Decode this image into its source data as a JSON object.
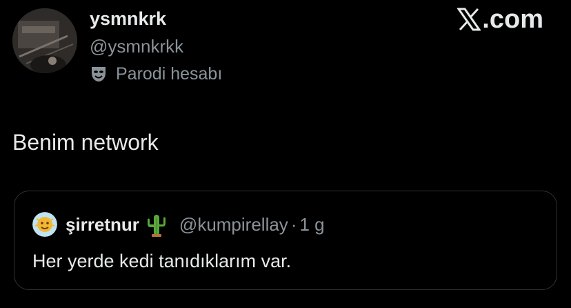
{
  "author": {
    "display_name": "ysmnkrk",
    "handle": "@ysmnkrkk",
    "badge_label": "Parodi hesabı",
    "badge_icon": "theater-mask-icon"
  },
  "watermark": {
    "text": ".com",
    "icon": "x-logo-icon"
  },
  "tweet": {
    "text": "Benim network"
  },
  "quoted_tweet": {
    "display_name": "şirretnur",
    "name_emoji": "cactus-icon",
    "handle": "@kumpirellay",
    "separator": "·",
    "time": "1 g",
    "text": "Her yerde kedi tanıdıklarım var."
  },
  "colors": {
    "background": "#000000",
    "primary_text": "#e7e9ea",
    "secondary_text": "#8b9399",
    "border": "#2f3336"
  }
}
